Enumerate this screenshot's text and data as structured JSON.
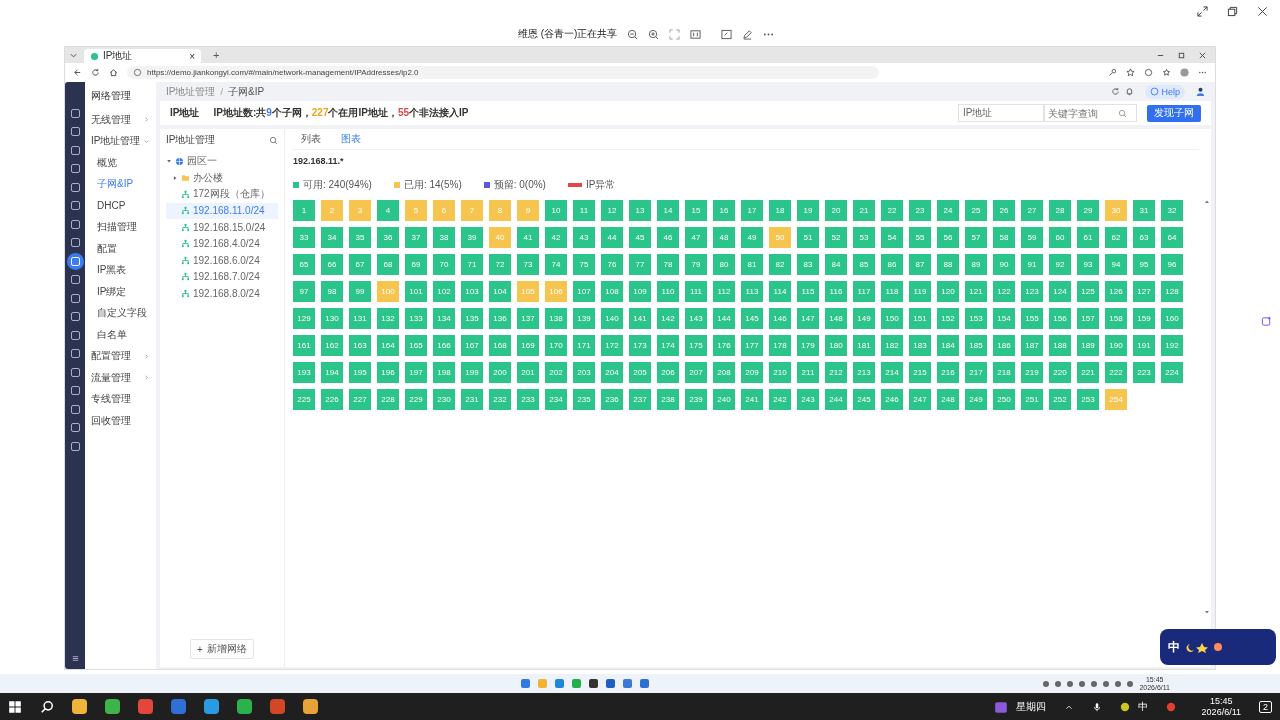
{
  "share_bar": {
    "title": "维恩 (谷青一)正在共享"
  },
  "browser": {
    "tab": {
      "title": "IP地址",
      "close": "×"
    },
    "new_tab": "+",
    "url": "https://demo.jiankongyi.com/#/main/network-management/IPAddresses/ip2.0"
  },
  "app": {
    "section_title": "网络管理",
    "rail": [
      {
        "selected": false
      },
      {
        "selected": false
      },
      {
        "selected": false
      },
      {
        "selected": false
      },
      {
        "selected": false
      },
      {
        "selected": false
      },
      {
        "selected": false
      },
      {
        "selected": false
      },
      {
        "selected": true
      },
      {
        "selected": false
      },
      {
        "selected": false
      },
      {
        "selected": false
      },
      {
        "selected": false
      },
      {
        "selected": false
      },
      {
        "selected": false
      },
      {
        "selected": false
      },
      {
        "selected": false
      },
      {
        "selected": false
      },
      {
        "selected": false
      }
    ],
    "menu": [
      {
        "label": "无线管理",
        "expanded": false
      },
      {
        "label": "IP地址管理",
        "expanded": true,
        "children": [
          {
            "label": "概览",
            "selected": false
          },
          {
            "label": "子网&IP",
            "selected": true
          },
          {
            "label": "DHCP",
            "selected": false
          },
          {
            "label": "扫描管理",
            "selected": false
          },
          {
            "label": "配置",
            "selected": false
          },
          {
            "label": "IP黑表",
            "selected": false
          },
          {
            "label": "IP绑定",
            "selected": false
          },
          {
            "label": "自定义字段",
            "selected": false
          },
          {
            "label": "白名单",
            "selected": false
          }
        ]
      },
      {
        "label": "配置管理",
        "expanded": false
      },
      {
        "label": "流量管理",
        "expanded": false
      },
      {
        "label": "专线管理"
      },
      {
        "label": "回收管理"
      }
    ],
    "breadcrumb": [
      "IP地址管理",
      "子网&IP"
    ],
    "breadcrumb_separator": "/",
    "help": "Help",
    "summary": {
      "label": "IP地址",
      "segments": [
        {
          "text": "IP地址数:共",
          "color": "#333333"
        },
        {
          "text": "9",
          "color": "#3b7cf0"
        },
        {
          "text": "个子网，",
          "color": "#333333"
        },
        {
          "text": "227",
          "color": "#f0a020"
        },
        {
          "text": "个在用IP地址，",
          "color": "#333333"
        },
        {
          "text": "55",
          "color": "#e04848"
        },
        {
          "text": "个非法接入IP",
          "color": "#333333"
        }
      ]
    },
    "filter": {
      "field": "IP地址",
      "search_placeholder": "关键字查询",
      "button": "发现子网"
    },
    "tree_panel": {
      "title": "IP地址管理",
      "add_button": "新增网络",
      "add_icon": "+",
      "nodes": [
        {
          "label": "园区一",
          "kind": "site",
          "expanded": true,
          "children": [
            {
              "label": "办公楼",
              "kind": "folder",
              "expanded": false,
              "selected": false
            },
            {
              "label": "172网段（仓库）",
              "kind": "subnet",
              "selected": false
            },
            {
              "label": "192.168.11.0/24",
              "kind": "subnet",
              "selected": true
            },
            {
              "label": "192.168.15.0/24",
              "kind": "subnet",
              "selected": false
            },
            {
              "label": "192.168.4.0/24",
              "kind": "subnet",
              "selected": false
            },
            {
              "label": "192.168.6.0/24",
              "kind": "subnet",
              "selected": false
            },
            {
              "label": "192.168.7.0/24",
              "kind": "subnet",
              "selected": false
            },
            {
              "label": "192.168.8.0/24",
              "kind": "subnet",
              "selected": false
            }
          ]
        }
      ]
    },
    "tabs": [
      {
        "label": "列表",
        "selected": false
      },
      {
        "label": "图表",
        "selected": true
      }
    ],
    "subnet_title": "192.168.11.*",
    "legend": [
      {
        "label": "可用: 240(94%)",
        "color": "#2bc48a",
        "kind": "square"
      },
      {
        "label": "已用: 14(5%)",
        "color": "#f5c550",
        "kind": "square"
      },
      {
        "label": "预留: 0(0%)",
        "color": "#5a5ad8",
        "kind": "square"
      },
      {
        "label": "IP异常",
        "color": "#e04848",
        "kind": "bar"
      }
    ],
    "cells": [
      {
        "label": "1",
        "kind": "free"
      },
      {
        "label": "2",
        "kind": "used"
      },
      {
        "label": "3",
        "kind": "used"
      },
      {
        "label": "4",
        "kind": "free"
      },
      {
        "label": "5",
        "kind": "used"
      },
      {
        "label": "6",
        "kind": "used"
      },
      {
        "label": "7",
        "kind": "used"
      },
      {
        "label": "8",
        "kind": "used"
      },
      {
        "label": "9",
        "kind": "used"
      },
      {
        "label": "10",
        "kind": "free"
      },
      {
        "label": "11",
        "kind": "free"
      },
      {
        "label": "12",
        "kind": "free"
      },
      {
        "label": "13",
        "kind": "free"
      },
      {
        "label": "14",
        "kind": "free"
      },
      {
        "label": "15",
        "kind": "free"
      },
      {
        "label": "16",
        "kind": "free"
      },
      {
        "label": "17",
        "kind": "free"
      },
      {
        "label": "18",
        "kind": "free"
      },
      {
        "label": "19",
        "kind": "free"
      },
      {
        "label": "20",
        "kind": "free"
      },
      {
        "label": "21",
        "kind": "free"
      },
      {
        "label": "22",
        "kind": "free"
      },
      {
        "label": "23",
        "kind": "free"
      },
      {
        "label": "24",
        "kind": "free"
      },
      {
        "label": "25",
        "kind": "free"
      },
      {
        "label": "26",
        "kind": "free"
      },
      {
        "label": "27",
        "kind": "free"
      },
      {
        "label": "28",
        "kind": "free"
      },
      {
        "label": "29",
        "kind": "free"
      },
      {
        "label": "30",
        "kind": "used"
      },
      {
        "label": "31",
        "kind": "free"
      },
      {
        "label": "32",
        "kind": "free"
      },
      {
        "label": "33",
        "kind": "free"
      },
      {
        "label": "34",
        "kind": "free"
      },
      {
        "label": "35",
        "kind": "free"
      },
      {
        "label": "36",
        "kind": "free"
      },
      {
        "label": "37",
        "kind": "free"
      },
      {
        "label": "38",
        "kind": "free"
      },
      {
        "label": "39",
        "kind": "free"
      },
      {
        "label": "40",
        "kind": "used"
      },
      {
        "label": "41",
        "kind": "free"
      },
      {
        "label": "42",
        "kind": "free"
      },
      {
        "label": "43",
        "kind": "free"
      },
      {
        "label": "44",
        "kind": "free"
      },
      {
        "label": "45",
        "kind": "free"
      },
      {
        "label": "46",
        "kind": "free"
      },
      {
        "label": "47",
        "kind": "free"
      },
      {
        "label": "48",
        "kind": "free"
      },
      {
        "label": "49",
        "kind": "free"
      },
      {
        "label": "50",
        "kind": "used"
      },
      {
        "label": "51",
        "kind": "free"
      },
      {
        "label": "52",
        "kind": "free"
      },
      {
        "label": "53",
        "kind": "free"
      },
      {
        "label": "54",
        "kind": "free"
      },
      {
        "label": "55",
        "kind": "free"
      },
      {
        "label": "56",
        "kind": "free"
      },
      {
        "label": "57",
        "kind": "free"
      },
      {
        "label": "58",
        "kind": "free"
      },
      {
        "label": "59",
        "kind": "free"
      },
      {
        "label": "60",
        "kind": "free"
      },
      {
        "label": "61",
        "kind": "free"
      },
      {
        "label": "62",
        "kind": "free"
      },
      {
        "label": "63",
        "kind": "free"
      },
      {
        "label": "64",
        "kind": "free"
      },
      {
        "label": "65",
        "kind": "free"
      },
      {
        "label": "66",
        "kind": "free"
      },
      {
        "label": "67",
        "kind": "free"
      },
      {
        "label": "68",
        "kind": "free"
      },
      {
        "label": "69",
        "kind": "free"
      },
      {
        "label": "70",
        "kind": "free"
      },
      {
        "label": "71",
        "kind": "free"
      },
      {
        "label": "72",
        "kind": "free"
      },
      {
        "label": "73",
        "kind": "free"
      },
      {
        "label": "74",
        "kind": "free"
      },
      {
        "label": "75",
        "kind": "free"
      },
      {
        "label": "76",
        "kind": "free"
      },
      {
        "label": "77",
        "kind": "free"
      },
      {
        "label": "78",
        "kind": "free"
      },
      {
        "label": "79",
        "kind": "free"
      },
      {
        "label": "80",
        "kind": "free"
      },
      {
        "label": "81",
        "kind": "free"
      },
      {
        "label": "82",
        "kind": "free"
      },
      {
        "label": "83",
        "kind": "free"
      },
      {
        "label": "84",
        "kind": "free"
      },
      {
        "label": "85",
        "kind": "free"
      },
      {
        "label": "86",
        "kind": "free"
      },
      {
        "label": "87",
        "kind": "free"
      },
      {
        "label": "88",
        "kind": "free"
      },
      {
        "label": "89",
        "kind": "free"
      },
      {
        "label": "90",
        "kind": "free"
      },
      {
        "label": "91",
        "kind": "free"
      },
      {
        "label": "92",
        "kind": "free"
      },
      {
        "label": "93",
        "kind": "free"
      },
      {
        "label": "94",
        "kind": "free"
      },
      {
        "label": "95",
        "kind": "free"
      },
      {
        "label": "96",
        "kind": "free"
      },
      {
        "label": "97",
        "kind": "free"
      },
      {
        "label": "98",
        "kind": "free"
      },
      {
        "label": "99",
        "kind": "free"
      },
      {
        "label": "100",
        "kind": "used"
      },
      {
        "label": "101",
        "kind": "free"
      },
      {
        "label": "102",
        "kind": "free"
      },
      {
        "label": "103",
        "kind": "free"
      },
      {
        "label": "104",
        "kind": "free"
      },
      {
        "label": "105",
        "kind": "used"
      },
      {
        "label": "106",
        "kind": "used"
      },
      {
        "label": "107",
        "kind": "free"
      },
      {
        "label": "108",
        "kind": "free"
      },
      {
        "label": "109",
        "kind": "free"
      },
      {
        "label": "110",
        "kind": "free"
      },
      {
        "label": "111",
        "kind": "free"
      },
      {
        "label": "112",
        "kind": "free"
      },
      {
        "label": "113",
        "kind": "free"
      },
      {
        "label": "114",
        "kind": "free"
      },
      {
        "label": "115",
        "kind": "free"
      },
      {
        "label": "116",
        "kind": "free"
      },
      {
        "label": "117",
        "kind": "free"
      },
      {
        "label": "118",
        "kind": "free"
      },
      {
        "label": "119",
        "kind": "free"
      },
      {
        "label": "120",
        "kind": "free"
      },
      {
        "label": "121",
        "kind": "free"
      },
      {
        "label": "122",
        "kind": "free"
      },
      {
        "label": "123",
        "kind": "free"
      },
      {
        "label": "124",
        "kind": "free"
      },
      {
        "label": "125",
        "kind": "free"
      },
      {
        "label": "126",
        "kind": "free"
      },
      {
        "label": "127",
        "kind": "free"
      },
      {
        "label": "128",
        "kind": "free"
      },
      {
        "label": "129",
        "kind": "free"
      },
      {
        "label": "130",
        "kind": "free"
      },
      {
        "label": "131",
        "kind": "free"
      },
      {
        "label": "132",
        "kind": "free"
      },
      {
        "label": "133",
        "kind": "free"
      },
      {
        "label": "134",
        "kind": "free"
      },
      {
        "label": "135",
        "kind": "free"
      },
      {
        "label": "136",
        "kind": "free"
      },
      {
        "label": "137",
        "kind": "free"
      },
      {
        "label": "138",
        "kind": "free"
      },
      {
        "label": "139",
        "kind": "free"
      },
      {
        "label": "140",
        "kind": "free"
      },
      {
        "label": "141",
        "kind": "free"
      },
      {
        "label": "142",
        "kind": "free"
      },
      {
        "label": "143",
        "kind": "free"
      },
      {
        "label": "144",
        "kind": "free"
      },
      {
        "label": "145",
        "kind": "free"
      },
      {
        "label": "146",
        "kind": "free"
      },
      {
        "label": "147",
        "kind": "free"
      },
      {
        "label": "148",
        "kind": "free"
      },
      {
        "label": "149",
        "kind": "free"
      },
      {
        "label": "150",
        "kind": "free"
      },
      {
        "label": "151",
        "kind": "free"
      },
      {
        "label": "152",
        "kind": "free"
      },
      {
        "label": "153",
        "kind": "free"
      },
      {
        "label": "154",
        "kind": "free"
      },
      {
        "label": "155",
        "kind": "free"
      },
      {
        "label": "156",
        "kind": "free"
      },
      {
        "label": "157",
        "kind": "free"
      },
      {
        "label": "158",
        "kind": "free"
      },
      {
        "label": "159",
        "kind": "free"
      },
      {
        "label": "160",
        "kind": "free"
      },
      {
        "label": "161",
        "kind": "free"
      },
      {
        "label": "162",
        "kind": "free"
      },
      {
        "label": "163",
        "kind": "free"
      },
      {
        "label": "164",
        "kind": "free"
      },
      {
        "label": "165",
        "kind": "free"
      },
      {
        "label": "166",
        "kind": "free"
      },
      {
        "label": "167",
        "kind": "free"
      },
      {
        "label": "168",
        "kind": "free"
      },
      {
        "label": "169",
        "kind": "free"
      },
      {
        "label": "170",
        "kind": "free"
      },
      {
        "label": "171",
        "kind": "free"
      },
      {
        "label": "172",
        "kind": "free"
      },
      {
        "label": "173",
        "kind": "free"
      },
      {
        "label": "174",
        "kind": "free"
      },
      {
        "label": "175",
        "kind": "free"
      },
      {
        "label": "176",
        "kind": "free"
      },
      {
        "label": "177",
        "kind": "free"
      },
      {
        "label": "178",
        "kind": "free"
      },
      {
        "label": "179",
        "kind": "free"
      },
      {
        "label": "180",
        "kind": "free"
      },
      {
        "label": "181",
        "kind": "free"
      },
      {
        "label": "182",
        "kind": "free"
      },
      {
        "label": "183",
        "kind": "free"
      },
      {
        "label": "184",
        "kind": "free"
      },
      {
        "label": "185",
        "kind": "free"
      },
      {
        "label": "186",
        "kind": "free"
      },
      {
        "label": "187",
        "kind": "free"
      },
      {
        "label": "188",
        "kind": "free"
      },
      {
        "label": "189",
        "kind": "free"
      },
      {
        "label": "190",
        "kind": "free"
      },
      {
        "label": "191",
        "kind": "free"
      },
      {
        "label": "192",
        "kind": "free"
      },
      {
        "label": "193",
        "kind": "free"
      },
      {
        "label": "194",
        "kind": "free"
      },
      {
        "label": "195",
        "kind": "free"
      },
      {
        "label": "196",
        "kind": "free"
      },
      {
        "label": "197",
        "kind": "free"
      },
      {
        "label": "198",
        "kind": "free"
      },
      {
        "label": "199",
        "kind": "free"
      },
      {
        "label": "200",
        "kind": "free"
      },
      {
        "label": "201",
        "kind": "free"
      },
      {
        "label": "202",
        "kind": "free"
      },
      {
        "label": "203",
        "kind": "free"
      },
      {
        "label": "204",
        "kind": "free"
      },
      {
        "label": "205",
        "kind": "free"
      },
      {
        "label": "206",
        "kind": "free"
      },
      {
        "label": "207",
        "kind": "free"
      },
      {
        "label": "208",
        "kind": "free"
      },
      {
        "label": "209",
        "kind": "free"
      },
      {
        "label": "210",
        "kind": "free"
      },
      {
        "label": "211",
        "kind": "free"
      },
      {
        "label": "212",
        "kind": "free"
      },
      {
        "label": "213",
        "kind": "free"
      },
      {
        "label": "214",
        "kind": "free"
      },
      {
        "label": "215",
        "kind": "free"
      },
      {
        "label": "216",
        "kind": "free"
      },
      {
        "label": "217",
        "kind": "free"
      },
      {
        "label": "218",
        "kind": "free"
      },
      {
        "label": "219",
        "kind": "free"
      },
      {
        "label": "220",
        "kind": "free"
      },
      {
        "label": "221",
        "kind": "free"
      },
      {
        "label": "222",
        "kind": "free"
      },
      {
        "label": "223",
        "kind": "free"
      },
      {
        "label": "224",
        "kind": "free"
      },
      {
        "label": "225",
        "kind": "free"
      },
      {
        "label": "226",
        "kind": "free"
      },
      {
        "label": "227",
        "kind": "free"
      },
      {
        "label": "228",
        "kind": "free"
      },
      {
        "label": "229",
        "kind": "free"
      },
      {
        "label": "230",
        "kind": "free"
      },
      {
        "label": "231",
        "kind": "free"
      },
      {
        "label": "232",
        "kind": "free"
      },
      {
        "label": "233",
        "kind": "free"
      },
      {
        "label": "234",
        "kind": "free"
      },
      {
        "label": "235",
        "kind": "free"
      },
      {
        "label": "236",
        "kind": "free"
      },
      {
        "label": "237",
        "kind": "free"
      },
      {
        "label": "238",
        "kind": "free"
      },
      {
        "label": "239",
        "kind": "free"
      },
      {
        "label": "240",
        "kind": "free"
      },
      {
        "label": "241",
        "kind": "free"
      },
      {
        "label": "242",
        "kind": "free"
      },
      {
        "label": "243",
        "kind": "free"
      },
      {
        "label": "244",
        "kind": "free"
      },
      {
        "label": "245",
        "kind": "free"
      },
      {
        "label": "246",
        "kind": "free"
      },
      {
        "label": "247",
        "kind": "free"
      },
      {
        "label": "248",
        "kind": "free"
      },
      {
        "label": "249",
        "kind": "free"
      },
      {
        "label": "250",
        "kind": "free"
      },
      {
        "label": "251",
        "kind": "free"
      },
      {
        "label": "252",
        "kind": "free"
      },
      {
        "label": "253",
        "kind": "free"
      },
      {
        "label": "254",
        "kind": "used"
      }
    ]
  },
  "inner_taskbar": {
    "time": "15:45",
    "date": "2026/6/11"
  },
  "taskbar": {
    "weekday": "星期四",
    "ime": "中",
    "time": "15:45",
    "date": "2026/6/11",
    "notifications": "2"
  },
  "ime_widget": {
    "label": "中"
  }
}
